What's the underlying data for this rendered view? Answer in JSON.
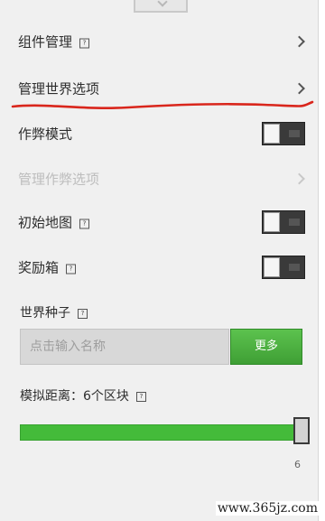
{
  "settings": {
    "manage_components": {
      "label": "组件管理"
    },
    "manage_world_options": {
      "label": "管理世界选项"
    },
    "cheat_mode": {
      "label": "作弊模式",
      "enabled": false
    },
    "manage_cheat_options": {
      "label": "管理作弊选项",
      "disabled": true
    },
    "starting_map": {
      "label": "初始地图",
      "enabled": false
    },
    "bonus_chest": {
      "label": "奖励箱",
      "enabled": false
    }
  },
  "world_seed": {
    "label": "世界种子",
    "placeholder": "点击输入名称",
    "more_button": "更多"
  },
  "simulation_distance": {
    "label": "模拟距离：6个区块",
    "value": 6,
    "value_label": "6",
    "fill_fraction": 1.0
  },
  "icons": {
    "help": "help-icon",
    "chevron": "chevron-right-icon"
  },
  "colors": {
    "accent_green": "#44bb3a",
    "annotation_red": "#d9261c",
    "panel_bg": "#f0f0f0"
  },
  "watermark": "www.365jz.com"
}
